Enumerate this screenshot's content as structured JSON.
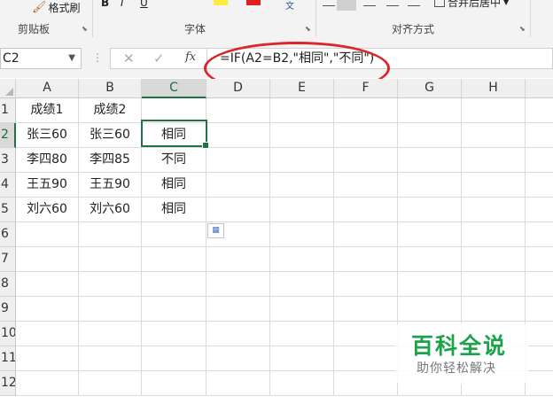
{
  "ribbon": {
    "format_painter_label": "格式刷",
    "clipboard_group": "剪贴板",
    "font_group": "字体",
    "alignment_group": "对齐方式",
    "merge_center_label": "合并后居中",
    "bold": "B",
    "italic": "I",
    "underline": "U"
  },
  "formula_bar": {
    "name_box": "C2",
    "cancel": "✕",
    "enter": "✓",
    "fx": "fx",
    "formula": "=IF(A2=B2,\"相同\",\"不同\")"
  },
  "columns": [
    "A",
    "B",
    "C",
    "D",
    "E",
    "F",
    "G",
    "H"
  ],
  "rows": [
    "1",
    "2",
    "3",
    "4",
    "5",
    "6",
    "7",
    "8",
    "9",
    "10",
    "11",
    "12"
  ],
  "selected_cell": "C2",
  "cells": {
    "A1": "成绩1",
    "B1": "成绩2",
    "C1": "",
    "A2": "张三60",
    "B2": "张三60",
    "C2": "相同",
    "A3": "李四80",
    "B3": "李四85",
    "C3": "不同",
    "A4": "王五90",
    "B4": "王五90",
    "C4": "相同",
    "A5": "刘六60",
    "B5": "刘六60",
    "C5": "相同"
  },
  "watermark": {
    "logo": "百科全说",
    "subtitle": "助你轻松解决"
  },
  "colors": {
    "excel_green": "#217346",
    "annotation_red": "#d9272b",
    "watermark_green": "#1aa34a"
  }
}
